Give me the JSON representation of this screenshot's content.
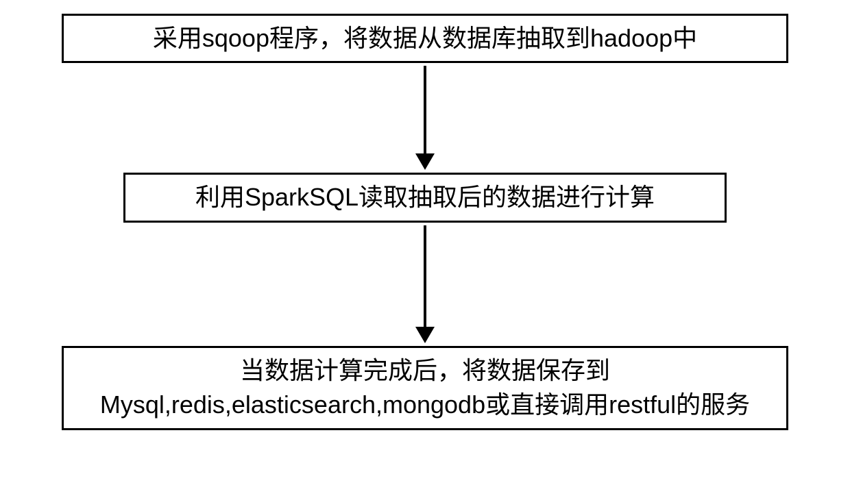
{
  "flowchart": {
    "steps": [
      {
        "id": "step1",
        "text": "采用sqoop程序，将数据从数据库抽取到hadoop中"
      },
      {
        "id": "step2",
        "text": "利用SparkSQL读取抽取后的数据进行计算"
      },
      {
        "id": "step3",
        "text": "当数据计算完成后，将数据保存到Mysql,redis,elasticsearch,mongodb或直接调用restful的服务"
      }
    ]
  }
}
